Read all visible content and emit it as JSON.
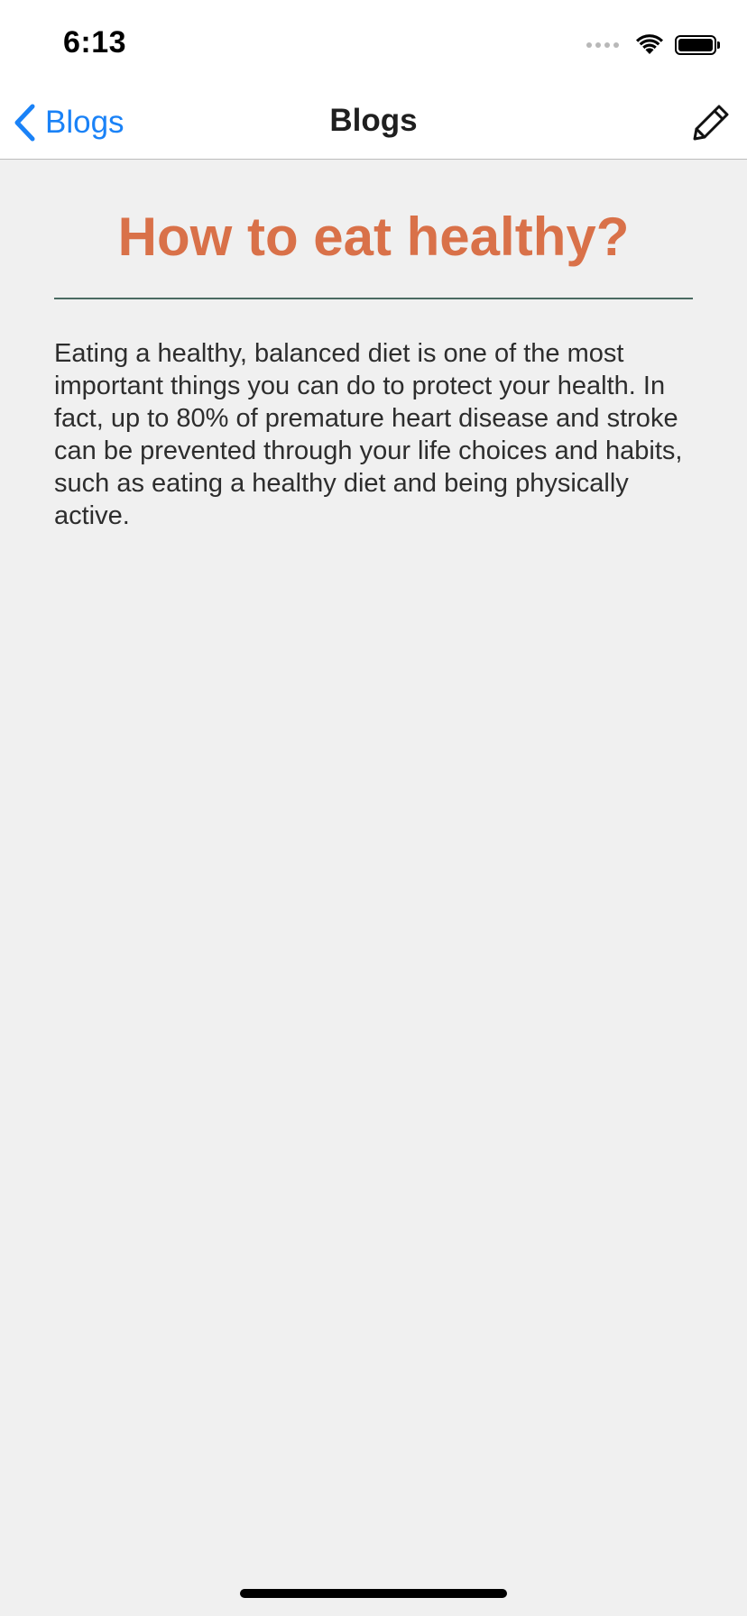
{
  "status_bar": {
    "time": "6:13"
  },
  "nav": {
    "back_label": "Blogs",
    "title": "Blogs",
    "accent_color": "#1a82f7"
  },
  "article": {
    "title": "How to eat healthy?",
    "title_color": "#d97149",
    "body": "Eating a healthy, balanced diet is one of the most important things you can do to protect your health. In fact, up to 80% of premature heart disease and stroke can be prevented through your life choices and habits, such as eating a healthy diet and being physically active."
  },
  "icons": {
    "back": "chevron-left-icon",
    "edit": "pencil-icon",
    "wifi": "wifi-icon",
    "battery": "battery-icon"
  }
}
